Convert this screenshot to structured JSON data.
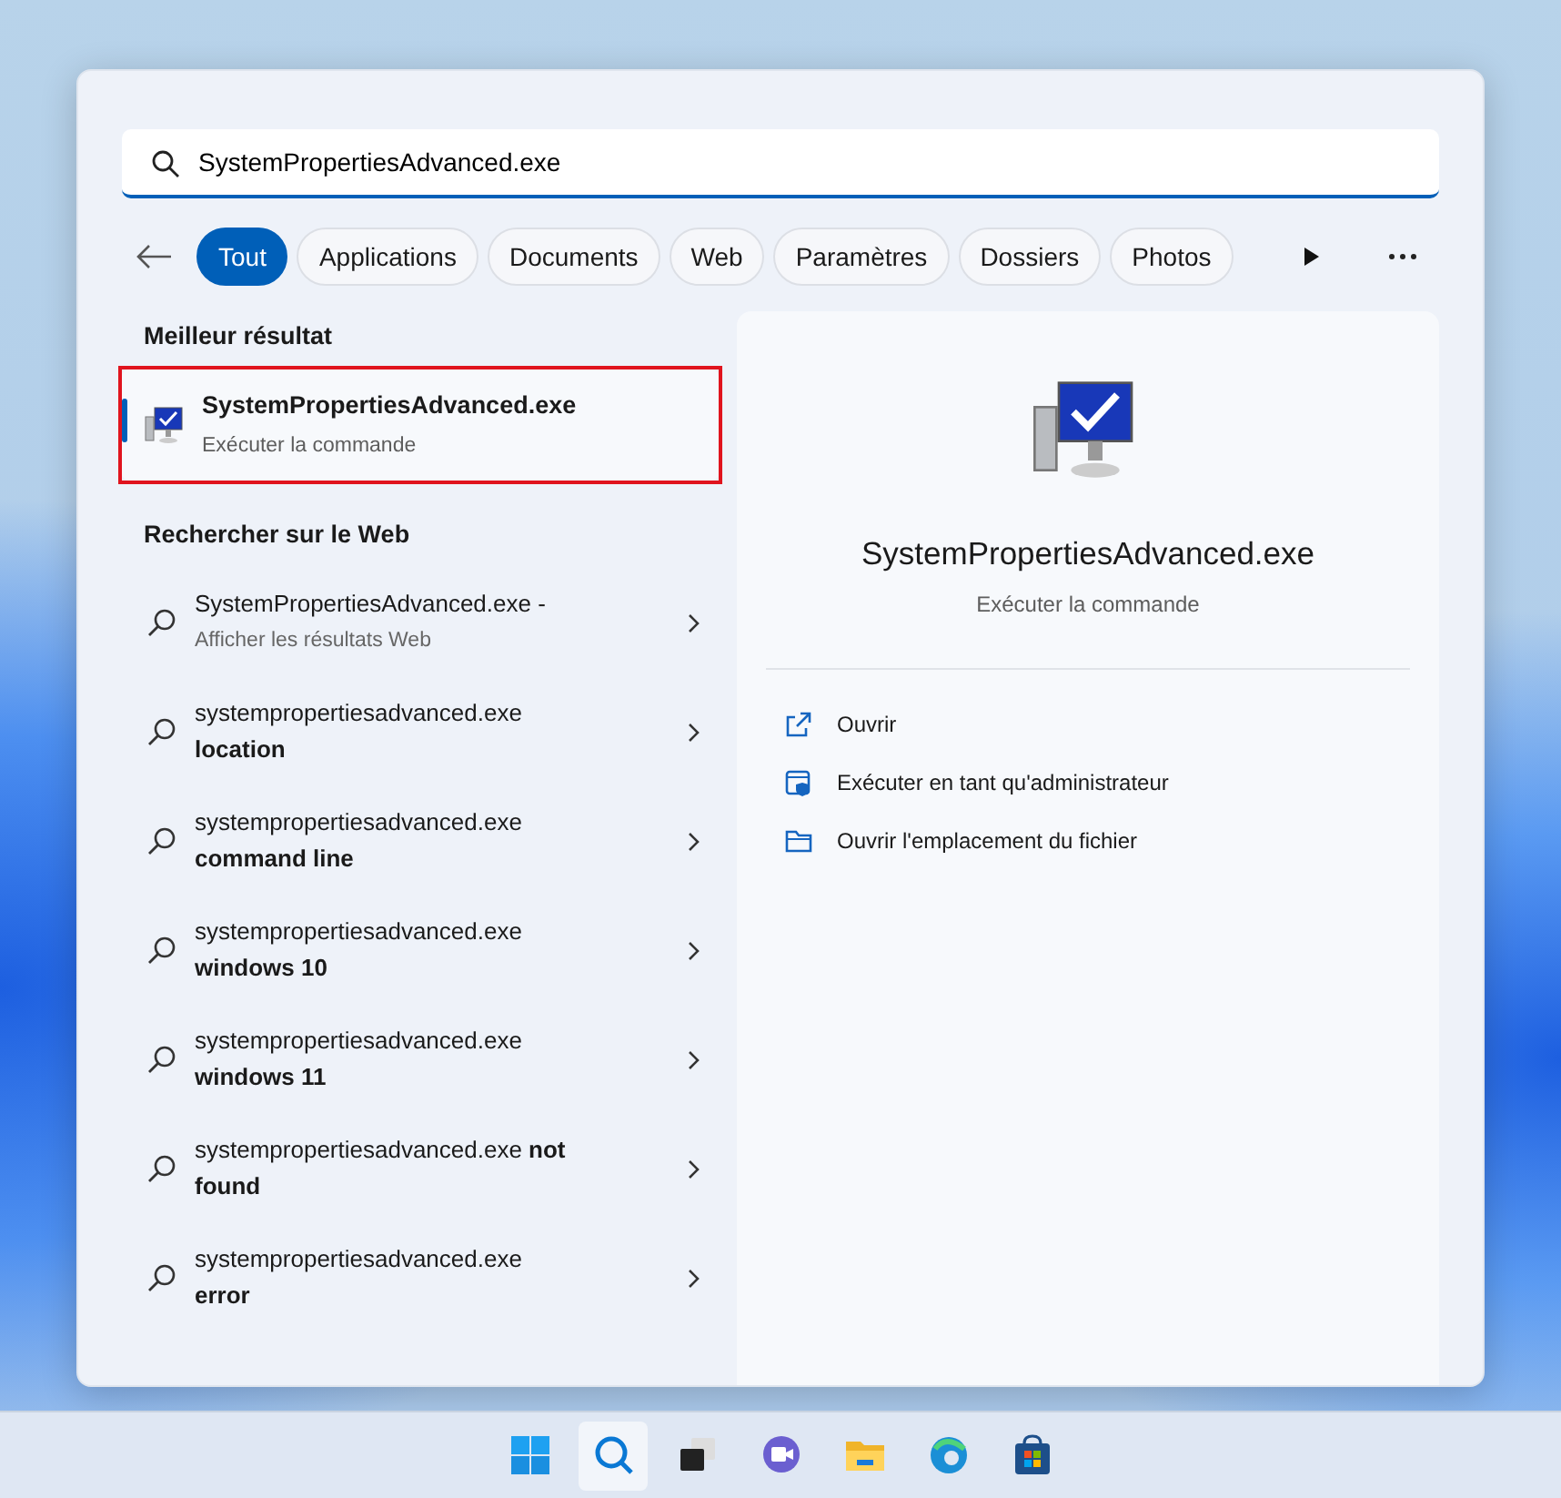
{
  "search": {
    "value": "SystemPropertiesAdvanced.exe"
  },
  "filters": [
    {
      "label": "Tout",
      "selected": true
    },
    {
      "label": "Applications",
      "selected": false
    },
    {
      "label": "Documents",
      "selected": false
    },
    {
      "label": "Web",
      "selected": false
    },
    {
      "label": "Paramètres",
      "selected": false
    },
    {
      "label": "Dossiers",
      "selected": false
    },
    {
      "label": "Photos",
      "selected": false
    }
  ],
  "best_match": {
    "heading": "Meilleur résultat",
    "title": "SystemPropertiesAdvanced.exe",
    "subtitle": "Exécuter la commande",
    "selected": true,
    "highlighted": true
  },
  "web_search": {
    "heading": "Rechercher sur le Web",
    "items": [
      {
        "kind": "subtitle",
        "line_1": "SystemPropertiesAdvanced.exe -",
        "line_2": "Afficher les résultats Web"
      },
      {
        "kind": "bold",
        "line_1": "systempropertiesadvanced.exe",
        "line_2": "location"
      },
      {
        "kind": "bold",
        "line_1": "systempropertiesadvanced.exe",
        "line_2": "command line"
      },
      {
        "kind": "bold",
        "line_1": "systempropertiesadvanced.exe",
        "line_2": "windows 10"
      },
      {
        "kind": "bold",
        "line_1": "systempropertiesadvanced.exe",
        "line_2": "windows 11"
      },
      {
        "kind": "bold",
        "line_1": "systempropertiesadvanced.exe **not**",
        "line_2": "found"
      },
      {
        "kind": "bold",
        "line_1": "systempropertiesadvanced.exe",
        "line_2": "error"
      }
    ]
  },
  "detail": {
    "title": "SystemPropertiesAdvanced.exe",
    "subtitle": "Exécuter la commande",
    "actions": [
      {
        "kind": "open",
        "label": "Ouvrir"
      },
      {
        "kind": "admin",
        "label": "Exécuter en tant qu'administrateur"
      },
      {
        "kind": "folder",
        "label": "Ouvrir l'emplacement du fichier"
      }
    ]
  },
  "taskbar": [
    {
      "kind": "start",
      "selected": false
    },
    {
      "kind": "search",
      "selected": true
    },
    {
      "kind": "taskview",
      "selected": false
    },
    {
      "kind": "chat",
      "selected": false
    },
    {
      "kind": "explorer",
      "selected": false
    },
    {
      "kind": "edge",
      "selected": false
    },
    {
      "kind": "store",
      "selected": false
    }
  ]
}
